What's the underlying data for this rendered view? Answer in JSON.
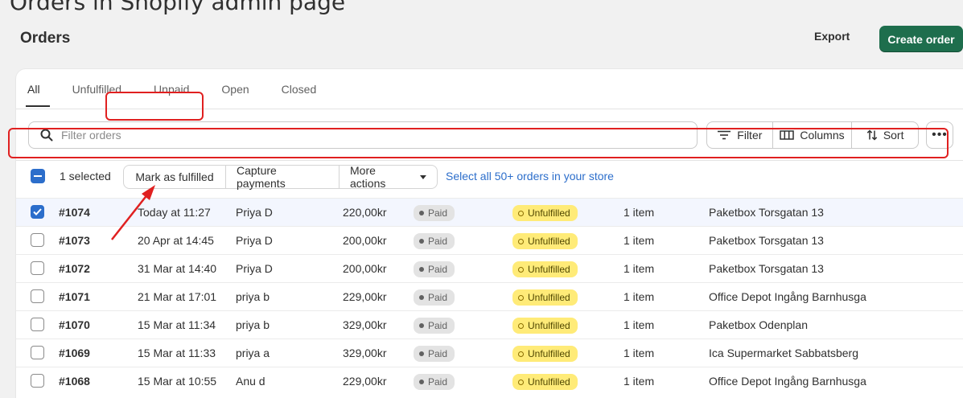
{
  "caption": "Orders in Shopify admin page",
  "header": {
    "title": "Orders",
    "export_label": "Export",
    "create_label": "Create order",
    "accent_color": "#1e6e4d"
  },
  "tabs": [
    {
      "label": "All",
      "active": true
    },
    {
      "label": "Unfulfilled",
      "active": false
    },
    {
      "label": "Unpaid",
      "active": false
    },
    {
      "label": "Open",
      "active": false
    },
    {
      "label": "Closed",
      "active": false
    }
  ],
  "search": {
    "placeholder": "Filter orders",
    "icon": "search-icon"
  },
  "toolbar": {
    "filter_label": "Filter",
    "columns_label": "Columns",
    "sort_label": "Sort",
    "more_icon": "ellipsis-icon"
  },
  "bulk": {
    "selected_label": "1 selected",
    "mark_fulfilled_label": "Mark as fulfilled",
    "capture_payments_label": "Capture payments",
    "more_actions_label": "More actions",
    "select_all_label": "Select all 50+ orders in your store"
  },
  "orders": [
    {
      "order": "#1074",
      "date": "Today at 11:27",
      "customer": "Priya D",
      "total": "220,00kr",
      "payment": "Paid",
      "fulfillment": "Unfulfilled",
      "items": "1 item",
      "delivery": "Paketbox Torsgatan 13",
      "selected": true
    },
    {
      "order": "#1073",
      "date": "20 Apr at 14:45",
      "customer": "Priya D",
      "total": "200,00kr",
      "payment": "Paid",
      "fulfillment": "Unfulfilled",
      "items": "1 item",
      "delivery": "Paketbox Torsgatan 13",
      "selected": false
    },
    {
      "order": "#1072",
      "date": "31 Mar at 14:40",
      "customer": "Priya D",
      "total": "200,00kr",
      "payment": "Paid",
      "fulfillment": "Unfulfilled",
      "items": "1 item",
      "delivery": "Paketbox Torsgatan 13",
      "selected": false
    },
    {
      "order": "#1071",
      "date": "21 Mar at 17:01",
      "customer": "priya b",
      "total": "229,00kr",
      "payment": "Paid",
      "fulfillment": "Unfulfilled",
      "items": "1 item",
      "delivery": "Office Depot Ingång Barnhusga",
      "selected": false
    },
    {
      "order": "#1070",
      "date": "15 Mar at 11:34",
      "customer": "priya b",
      "total": "329,00kr",
      "payment": "Paid",
      "fulfillment": "Unfulfilled",
      "items": "1 item",
      "delivery": "Paketbox Odenplan",
      "selected": false
    },
    {
      "order": "#1069",
      "date": "15 Mar at 11:33",
      "customer": "priya a",
      "total": "329,00kr",
      "payment": "Paid",
      "fulfillment": "Unfulfilled",
      "items": "1 item",
      "delivery": "Ica Supermarket Sabbatsberg",
      "selected": false
    },
    {
      "order": "#1068",
      "date": "15 Mar at 10:55",
      "customer": "Anu d",
      "total": "229,00kr",
      "payment": "Paid",
      "fulfillment": "Unfulfilled",
      "items": "1 item",
      "delivery": "Office Depot Ingång Barnhusga",
      "selected": false
    }
  ],
  "colors": {
    "annotation": "#e02020",
    "checkbox_selected": "#2c6ecb",
    "unfulfilled_badge": "#ffeb78",
    "paid_badge": "#e3e3e3"
  }
}
